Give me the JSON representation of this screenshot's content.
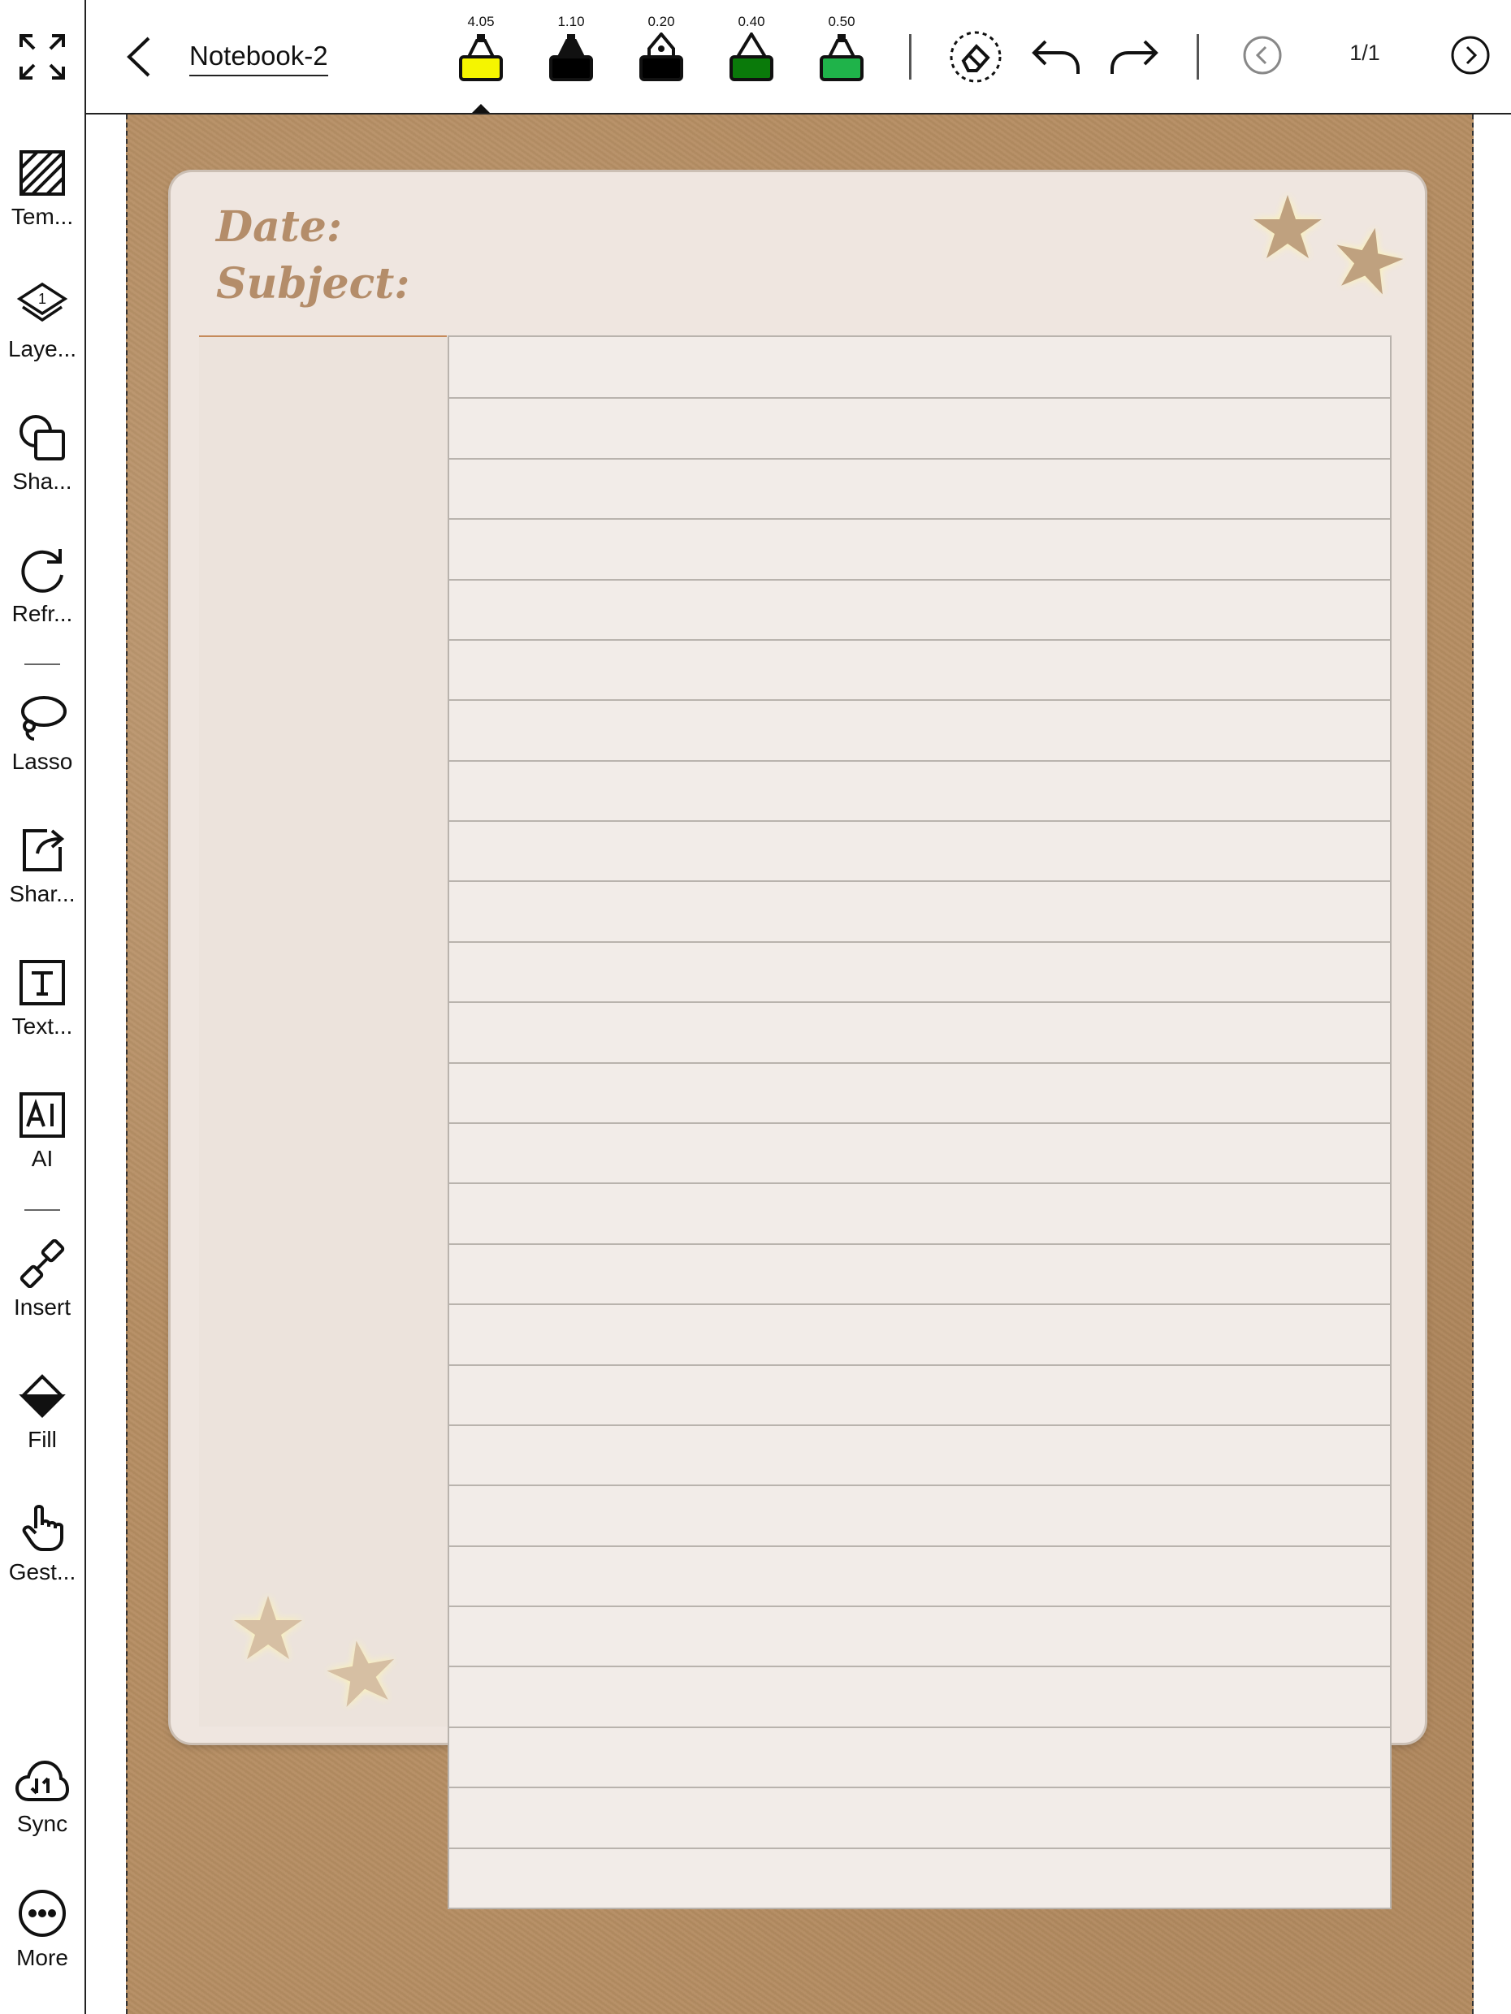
{
  "toolbar": {
    "title": "Notebook-2",
    "page_indicator": "1/1",
    "pens": [
      {
        "value": "4.05",
        "color": "#f5f500",
        "type": "highlighter",
        "selected": true
      },
      {
        "value": "1.10",
        "color": "#000000",
        "type": "marker"
      },
      {
        "value": "0.20",
        "color": "#000000",
        "type": "fountain"
      },
      {
        "value": "0.40",
        "color": "#0a7a0a",
        "type": "pencil"
      },
      {
        "value": "0.50",
        "color": "#1fb34a",
        "type": "highlighter"
      }
    ],
    "icons": [
      "fullscreen-icon",
      "back-arrow-icon",
      "eraser-icon",
      "undo-icon",
      "redo-icon",
      "prev-page-icon",
      "next-page-icon"
    ]
  },
  "sidebar": {
    "items": [
      {
        "label": "Tem...",
        "icon": "template-icon"
      },
      {
        "label": "Laye...",
        "icon": "layers-icon",
        "badge": "1"
      },
      {
        "label": "Sha...",
        "icon": "shapes-icon"
      },
      {
        "label": "Refr...",
        "icon": "refresh-icon"
      },
      {
        "label": "Lasso",
        "icon": "lasso-icon"
      },
      {
        "label": "Shar...",
        "icon": "share-icon"
      },
      {
        "label": "Text...",
        "icon": "text-icon"
      },
      {
        "label": "AI",
        "icon": "ai-icon"
      },
      {
        "label": "Insert",
        "icon": "insert-link-icon"
      },
      {
        "label": "Fill",
        "icon": "fill-bucket-icon"
      },
      {
        "label": "Gest...",
        "icon": "gesture-hand-icon"
      },
      {
        "label": "Sync",
        "icon": "cloud-sync-icon"
      },
      {
        "label": "More",
        "icon": "more-icon"
      }
    ]
  },
  "page": {
    "date_label": "Date:",
    "subject_label": "Subject:",
    "ruled_line_count": 26,
    "colors": {
      "background": "#b58d62",
      "paper": "#efe6e0",
      "header_text": "#b48d6a",
      "star": "#bfa17f"
    }
  }
}
